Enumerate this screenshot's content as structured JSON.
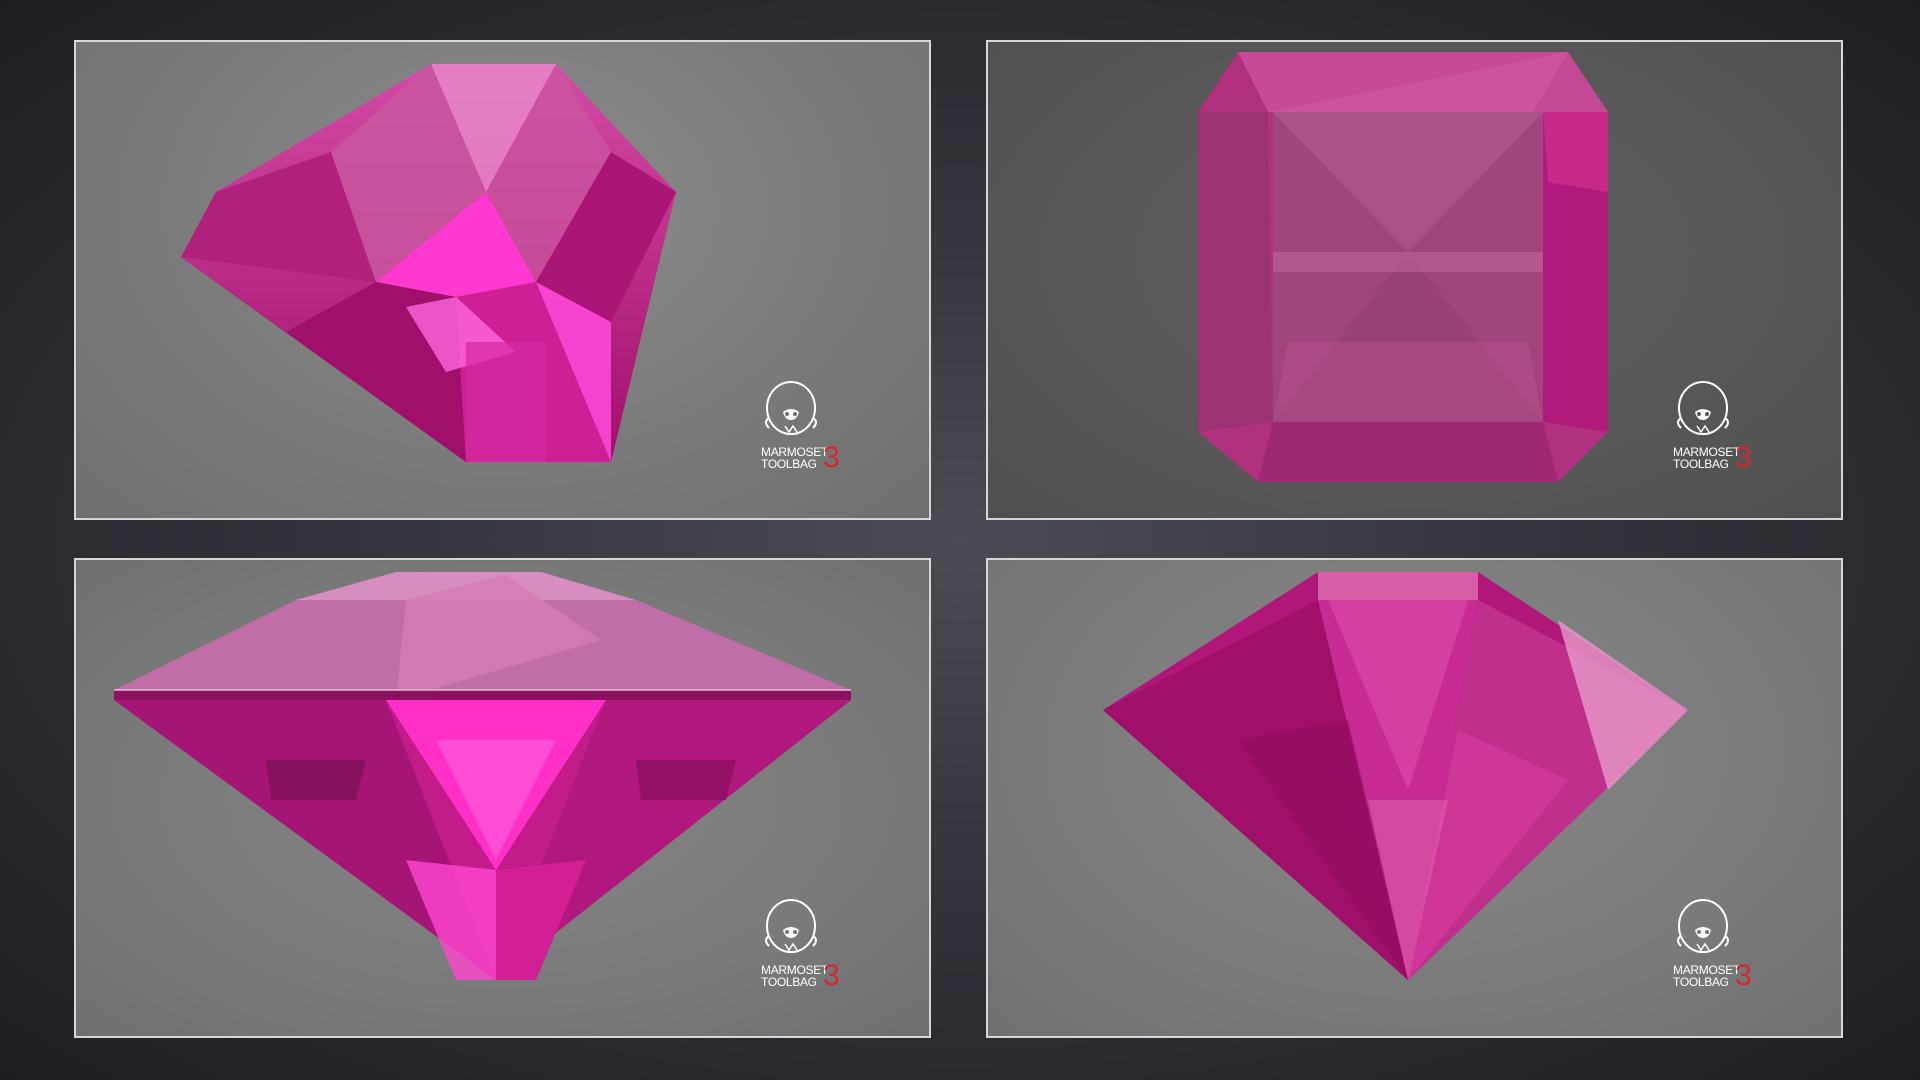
{
  "panels": [
    {
      "view": "top-oblique",
      "logo": {
        "line1": "MARMOSET",
        "line2": "TOOLBAG",
        "version": "3"
      }
    },
    {
      "view": "top-down",
      "logo": {
        "line1": "MARMOSET",
        "line2": "TOOLBAG",
        "version": "3"
      }
    },
    {
      "view": "side",
      "logo": {
        "line1": "MARMOSET",
        "line2": "TOOLBAG",
        "version": "3"
      }
    },
    {
      "view": "pavilion",
      "logo": {
        "line1": "MARMOSET",
        "line2": "TOOLBAG",
        "version": "3"
      }
    }
  ],
  "colors": {
    "gem_base": "#c0197f",
    "gem_bright": "#ff3ed4",
    "gem_dark": "#7a0c4e",
    "logo_red": "#d8262e",
    "frame": "#d6d6d6"
  },
  "icons": [
    "monkey-skull-icon"
  ]
}
